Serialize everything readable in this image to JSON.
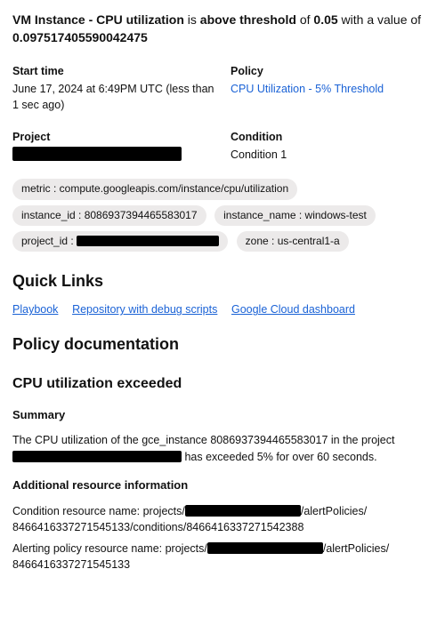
{
  "headline": {
    "subject": "VM Instance - CPU utilization",
    "mid1": " is ",
    "state": "above threshold",
    "mid2": " of ",
    "threshold": "0.05",
    "mid3": " with a value of ",
    "value": "0.097517405590042475"
  },
  "fields": {
    "start_time_label": "Start time",
    "start_time_val": "June 17, 2024 at 6:49PM UTC (less than 1 sec ago)",
    "policy_label": "Policy",
    "policy_val": "CPU Utilization - 5% Threshold",
    "project_label": "Project",
    "condition_label": "Condition",
    "condition_val": "Condition 1"
  },
  "chips": {
    "metric": "metric : compute.googleapis.com/instance/cpu/utilization",
    "instance_id": "instance_id : 8086937394465583017",
    "instance_name": "instance_name : windows-test",
    "project_id_prefix": "project_id : ",
    "zone": "zone : us-central1-a"
  },
  "quick_links": {
    "heading": "Quick Links",
    "playbook": "Playbook",
    "repo": "Repository with debug scripts",
    "dashboard": "Google Cloud dashboard"
  },
  "docs": {
    "heading": "Policy documentation",
    "subheading": "CPU utilization exceeded",
    "summary_label": "Summary",
    "summary_p1": "The CPU utilization of the gce_instance 8086937394465583017 in the project ",
    "summary_p2": " has exceeded 5% for over 60 seconds.",
    "addl_label": "Additional resource information",
    "cond_res_pre": "Condition resource name: projects/",
    "cond_res_mid": "/alertPolicies/",
    "cond_res_rest": "8466416337271545133/conditions/8466416337271542388",
    "alert_res_pre": "Alerting policy resource name: projects/",
    "alert_res_mid": "/alertPolicies/",
    "alert_res_rest": "8466416337271545133"
  }
}
